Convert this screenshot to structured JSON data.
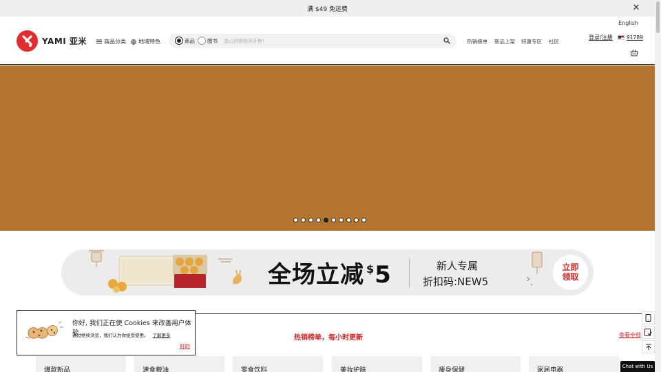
{
  "promo_bar": {
    "text": "满 $49 免运费",
    "close_icon": "close-icon"
  },
  "header": {
    "brand": "YAMI 亚米",
    "language": "English",
    "nav": [
      {
        "label": "商品分类",
        "icon": "menu-icon"
      },
      {
        "label": "地域特色",
        "icon": "globe-icon"
      }
    ],
    "search": {
      "options": [
        {
          "label": "商品",
          "selected": true
        },
        {
          "label": "图书",
          "selected": false
        }
      ],
      "placeholder": "流心月饼现货开售!",
      "icon": "search-icon"
    },
    "links": [
      "热销榜单",
      "新品上架",
      "特惠专区",
      "社区"
    ],
    "login": "登录/注册",
    "zip": "91789",
    "cart_icon": "cart-icon"
  },
  "hero": {
    "background": "#b4762e",
    "slides_total": 10,
    "active_slide": 5
  },
  "promo_banner": {
    "headline": "全场立减",
    "amount": "5",
    "currency": "$",
    "line1": "新人专属",
    "line2": "折扣码:NEW5",
    "button": "立即领取"
  },
  "bestsellers": {
    "title": "热销榜单，每小时更新",
    "view_all": "查看全部",
    "tabs": [
      "爆款新品",
      "速食粮油",
      "零食饮料",
      "美妆护肤",
      "瘦身保健",
      "家居电器"
    ]
  },
  "cookie_notice": {
    "title": "你好, 我们正在使 Cookies 来改善用户体验",
    "text": "通过继续浏览，我们认为你接受使用。",
    "learn_more": "了解更多",
    "ok": "好的"
  },
  "side_tools": [
    "tablet-icon",
    "checklist-icon",
    "back-to-top-icon"
  ],
  "chat": "Chat with Us",
  "colors": {
    "brand_red": "#e02e2e",
    "accent_red": "#d32626",
    "hero_bg": "#b4762e"
  }
}
